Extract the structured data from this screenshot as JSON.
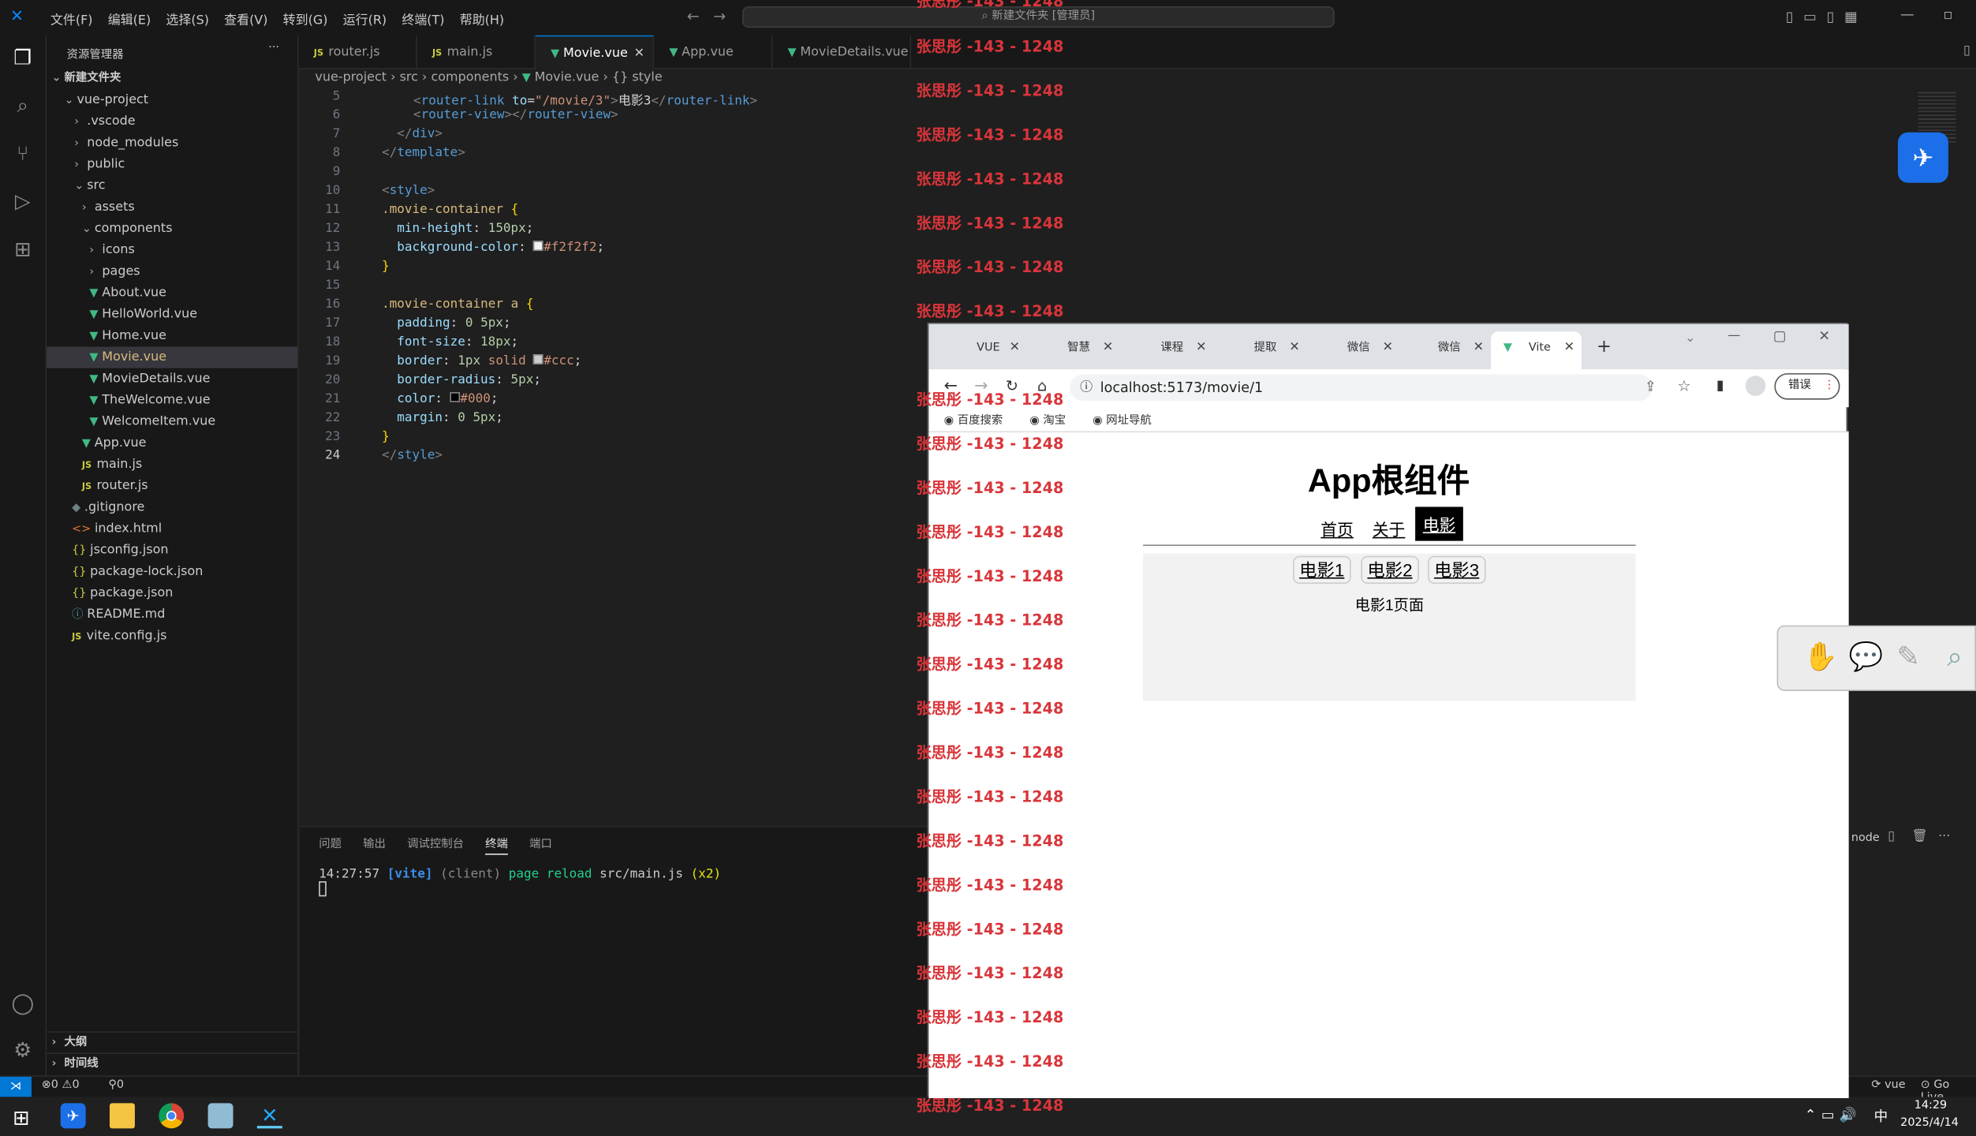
{
  "titlebar": {
    "menu": [
      "文件(F)",
      "编辑(E)",
      "选择(S)",
      "查看(V)",
      "转到(G)",
      "运行(R)",
      "终端(T)",
      "帮助(H)"
    ],
    "search": "新建文件夹 [管理员]"
  },
  "sidebar": {
    "title": "资源管理器",
    "more": "···",
    "workspace": "新建文件夹",
    "project": "vue-project",
    "items": [
      ".vscode",
      "node_modules",
      "public",
      "src",
      "assets",
      "components",
      "icons",
      "pages",
      "About.vue",
      "HelloWorld.vue",
      "Home.vue",
      "Movie.vue",
      "MovieDetails.vue",
      "TheWelcome.vue",
      "WelcomeItem.vue",
      "App.vue",
      "main.js",
      "router.js",
      ".gitignore",
      "index.html",
      "jsconfig.json",
      "package-lock.json",
      "package.json",
      "README.md",
      "vite.config.js"
    ],
    "outline": "大纲",
    "timeline": "时间线"
  },
  "tabs": [
    "router.js",
    "main.js",
    "Movie.vue",
    "App.vue",
    "MovieDetails.vue"
  ],
  "breadcrumb": [
    "vue-project",
    "src",
    "components",
    "Movie.vue",
    "{} style"
  ],
  "code": {
    "lines": [
      "5",
      "6",
      "7",
      "8",
      "9",
      "10",
      "11",
      "12",
      "13",
      "14",
      "15",
      "16",
      "17",
      "18",
      "19",
      "20",
      "21",
      "22",
      "23",
      "24"
    ]
  },
  "panel": {
    "tabs": [
      "问题",
      "输出",
      "调试控制台",
      "终端",
      "端口"
    ],
    "time": "14:27:57",
    "vite": "[vite]",
    "client": "(client)",
    "msg": "page reload",
    "file": "src/main.js",
    "count": "(x2)",
    "node": "node"
  },
  "statusbar": {
    "errors": "0",
    "warnings": "0",
    "ports": "0",
    "vue": "vue",
    "golive": "Go Live"
  },
  "taskbar": {
    "time": "14:29",
    "date": "2025/4/14",
    "ime": "中"
  },
  "watermark": "张思彤 -143 - 1248",
  "browser": {
    "tabs": [
      "VUE",
      "智慧",
      "课程",
      "提取",
      "微信",
      "微信",
      "Vite"
    ],
    "url": "localhost:5173/movie/1",
    "error": "错误",
    "bookmarks": [
      "百度搜索",
      "淘宝",
      "网址导航"
    ]
  },
  "app": {
    "title": "App根组件",
    "nav": [
      "首页",
      "关于",
      "电影"
    ],
    "movies": [
      "电影1",
      "电影2",
      "电影3"
    ],
    "content": "电影1页面"
  }
}
